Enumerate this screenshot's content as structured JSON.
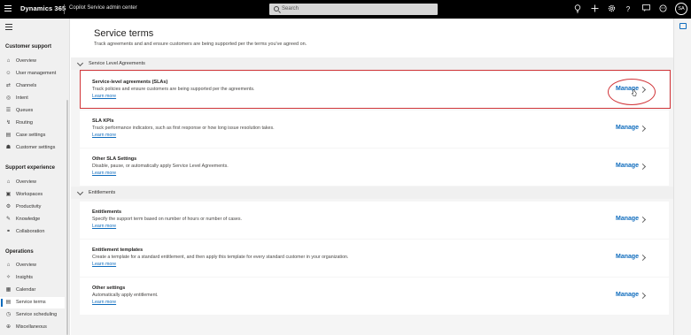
{
  "topbar": {
    "brand": "Dynamics 365",
    "app_name": "Copilot Service admin center",
    "search_placeholder": "Search",
    "icons": [
      "lightbulb-icon",
      "plus-icon",
      "gear-icon",
      "help-icon",
      "feedback-icon",
      "copilot-icon"
    ],
    "avatar": "SA"
  },
  "sidebar": {
    "groups": [
      {
        "title": "Customer support",
        "items": [
          {
            "label": "Overview",
            "icon": "home-icon"
          },
          {
            "label": "User management",
            "icon": "user-icon"
          },
          {
            "label": "Channels",
            "icon": "channels-icon"
          },
          {
            "label": "Intent",
            "icon": "intent-icon"
          },
          {
            "label": "Queues",
            "icon": "queue-icon"
          },
          {
            "label": "Routing",
            "icon": "routing-icon"
          },
          {
            "label": "Case settings",
            "icon": "case-icon"
          },
          {
            "label": "Customer settings",
            "icon": "customer-icon"
          }
        ]
      },
      {
        "title": "Support experience",
        "items": [
          {
            "label": "Overview",
            "icon": "home-icon"
          },
          {
            "label": "Workspaces",
            "icon": "workspace-icon"
          },
          {
            "label": "Productivity",
            "icon": "productivity-icon"
          },
          {
            "label": "Knowledge",
            "icon": "knowledge-icon"
          },
          {
            "label": "Collaboration",
            "icon": "collaboration-icon"
          }
        ]
      },
      {
        "title": "Operations",
        "items": [
          {
            "label": "Overview",
            "icon": "home-icon"
          },
          {
            "label": "Insights",
            "icon": "insights-icon"
          },
          {
            "label": "Calendar",
            "icon": "calendar-icon"
          },
          {
            "label": "Service terms",
            "icon": "service-terms-icon",
            "active": true
          },
          {
            "label": "Service scheduling",
            "icon": "scheduling-icon"
          },
          {
            "label": "Miscellaneous",
            "icon": "misc-icon"
          }
        ]
      }
    ]
  },
  "page": {
    "title": "Service terms",
    "subtitle": "Track agreements and and ensure customers are being supported per the terms you've agreed on."
  },
  "sections": [
    {
      "title": "Service Level Agreements",
      "cards": [
        {
          "title": "Service-level agreements (SLAs)",
          "description": "Track policies and ensure customers are being supported per the agreements.",
          "link": "Learn more",
          "action": "Manage"
        },
        {
          "title": "SLA KPIs",
          "description": "Track performance indicators, such as first response or how long issue resolution takes.",
          "link": "Learn more",
          "action": "Manage"
        },
        {
          "title": "Other SLA Settings",
          "description": "Disable, pause, or automatically apply Service Level Agreements.",
          "link": "Learn more",
          "action": "Manage"
        }
      ]
    },
    {
      "title": "Entitlements",
      "cards": [
        {
          "title": "Entitlements",
          "description": "Specify the support term based on number of hours or number of cases.",
          "link": "Learn more",
          "action": "Manage"
        },
        {
          "title": "Entitlement templates",
          "description": "Create a template for a standard entitlement, and then apply this template for every standard customer in your organization.",
          "link": "Learn more",
          "action": "Manage"
        },
        {
          "title": "Other settings",
          "description": "Automatically apply entitlement.",
          "link": "Learn more",
          "action": "Manage"
        }
      ]
    }
  ],
  "colors": {
    "accent": "#0f6cbd",
    "highlight": "#d13438",
    "topbar": "#000000"
  }
}
